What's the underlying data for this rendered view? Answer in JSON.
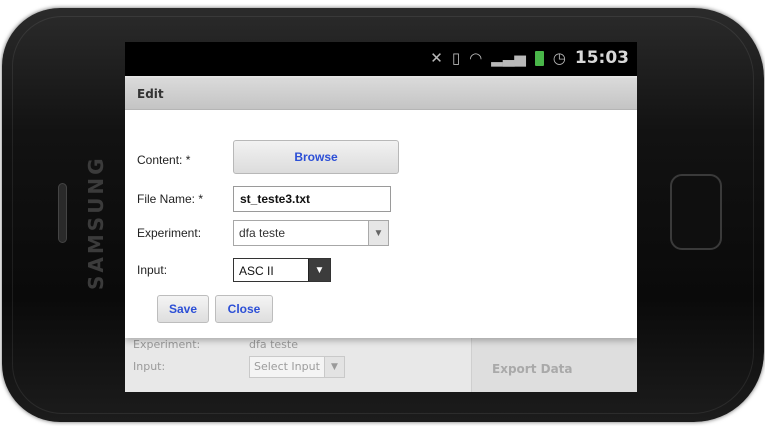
{
  "device": {
    "brand": "SAMSUNG"
  },
  "status_bar": {
    "time": "15:03"
  },
  "dialog": {
    "title": "Edit",
    "content_label": "Content: *",
    "browse_label": "Browse",
    "file_name_label": "File Name: *",
    "file_name_value": "st_teste3.txt",
    "experiment_label": "Experiment:",
    "experiment_value": "dfa teste",
    "input_label": "Input:",
    "input_value": "ASC II",
    "save_label": "Save",
    "close_label": "Close"
  },
  "background_page": {
    "experiment_label": "Experiment:",
    "experiment_value": "dfa teste",
    "input_label": "Input:",
    "input_placeholder": "Select Input",
    "export_label": "Export Data"
  }
}
